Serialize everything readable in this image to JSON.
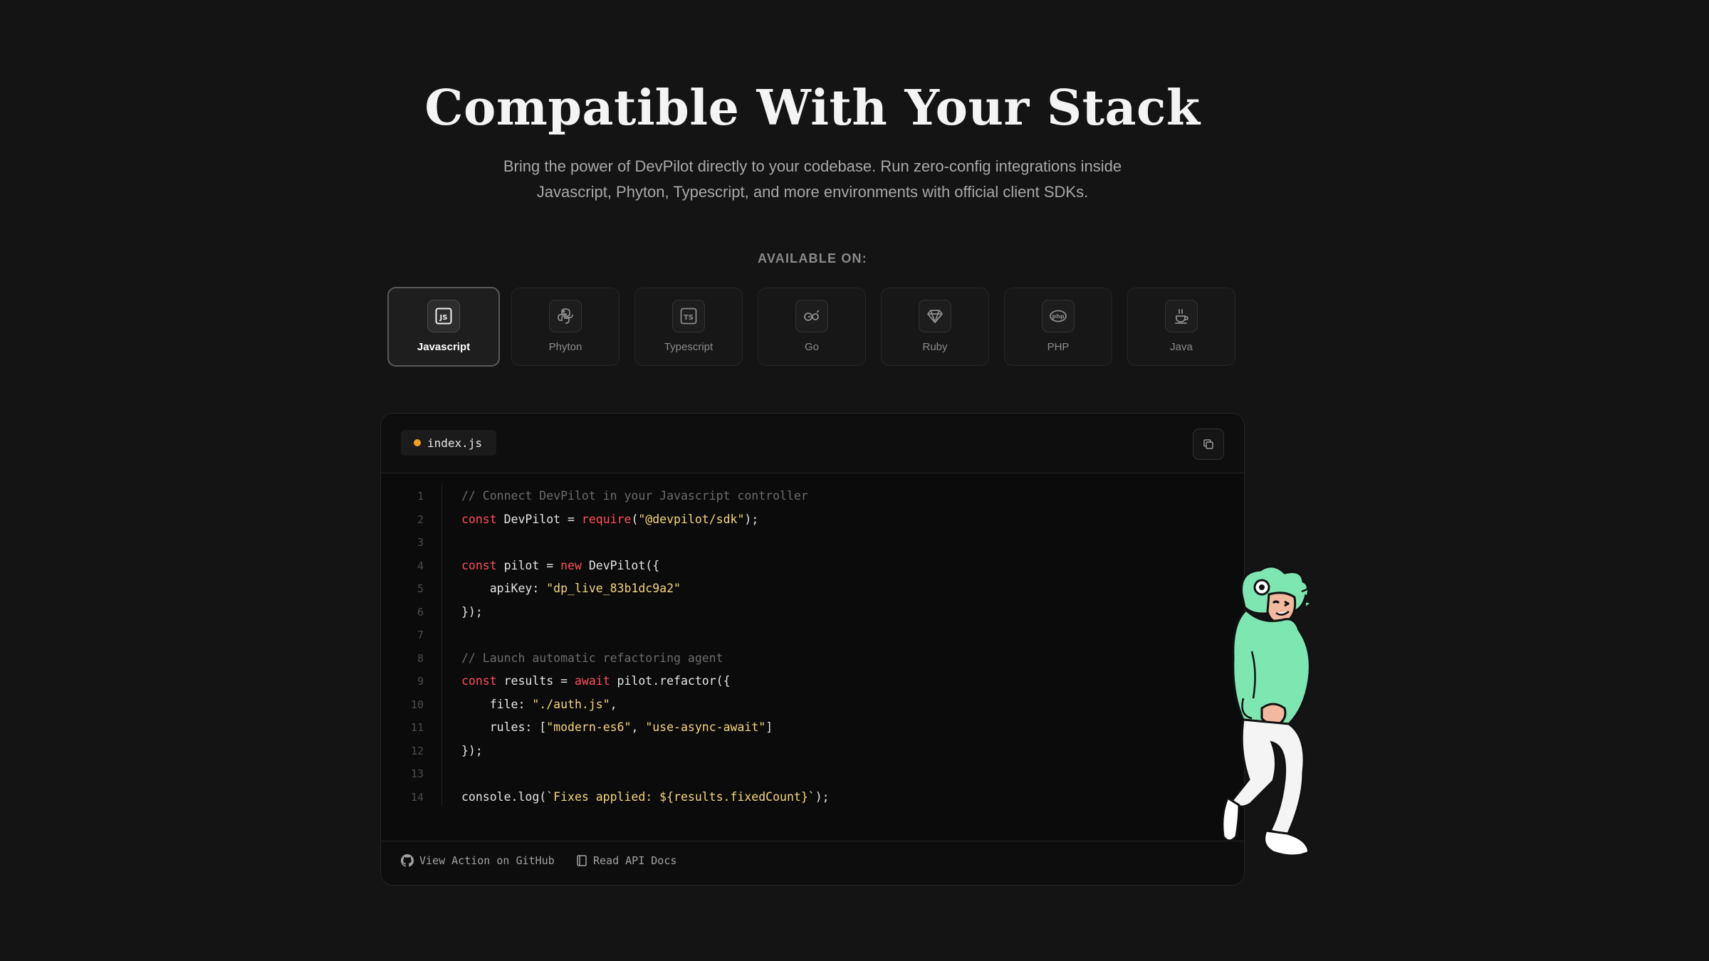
{
  "header": {
    "title": "Compatible With Your Stack",
    "subtitle_line1": "Bring the power of DevPilot directly to your codebase. Run zero-config integrations inside",
    "subtitle_line2": "Javascript, Phyton, Typescript, and more environments with official client SDKs.",
    "available_label": "AVAILABLE ON:"
  },
  "languages": [
    {
      "label": "Javascript",
      "icon": "javascript-icon",
      "active": true
    },
    {
      "label": "Phyton",
      "icon": "python-icon",
      "active": false
    },
    {
      "label": "Typescript",
      "icon": "typescript-icon",
      "active": false
    },
    {
      "label": "Go",
      "icon": "go-icon",
      "active": false
    },
    {
      "label": "Ruby",
      "icon": "ruby-icon",
      "active": false
    },
    {
      "label": "PHP",
      "icon": "php-icon",
      "active": false
    },
    {
      "label": "Java",
      "icon": "java-icon",
      "active": false
    }
  ],
  "editor": {
    "filename": "index.js",
    "file_dot_color": "#f0a020",
    "lines": [
      {
        "n": "1",
        "tokens": [
          [
            "cmt",
            "// Connect DevPilot in your Javascript controller"
          ]
        ]
      },
      {
        "n": "2",
        "tokens": [
          [
            "kw",
            "const"
          ],
          [
            "txt",
            " DevPilot = "
          ],
          [
            "kw",
            "require"
          ],
          [
            "txt",
            "("
          ],
          [
            "str",
            "\"@devpilot/sdk\""
          ],
          [
            "txt",
            ");"
          ]
        ]
      },
      {
        "n": "3",
        "tokens": []
      },
      {
        "n": "4",
        "tokens": [
          [
            "kw",
            "const"
          ],
          [
            "txt",
            " pilot = "
          ],
          [
            "kw",
            "new"
          ],
          [
            "txt",
            " DevPilot({"
          ]
        ]
      },
      {
        "n": "5",
        "tokens": [
          [
            "txt",
            "    apiKey: "
          ],
          [
            "str",
            "\"dp_live_83b1dc9a2\""
          ]
        ]
      },
      {
        "n": "6",
        "tokens": [
          [
            "txt",
            "});"
          ]
        ]
      },
      {
        "n": "7",
        "tokens": []
      },
      {
        "n": "8",
        "tokens": [
          [
            "cmt",
            "// Launch automatic refactoring agent"
          ]
        ]
      },
      {
        "n": "9",
        "tokens": [
          [
            "kw",
            "const"
          ],
          [
            "txt",
            " results = "
          ],
          [
            "kw",
            "await"
          ],
          [
            "txt",
            " pilot.refactor({"
          ]
        ]
      },
      {
        "n": "10",
        "tokens": [
          [
            "txt",
            "    file: "
          ],
          [
            "str",
            "\"./auth.js\""
          ],
          [
            "txt",
            ","
          ]
        ]
      },
      {
        "n": "11",
        "tokens": [
          [
            "txt",
            "    rules: ["
          ],
          [
            "str",
            "\"modern-es6\""
          ],
          [
            "txt",
            ", "
          ],
          [
            "str",
            "\"use-async-await\""
          ],
          [
            "txt",
            "]"
          ]
        ]
      },
      {
        "n": "12",
        "tokens": [
          [
            "txt",
            "});"
          ]
        ]
      },
      {
        "n": "13",
        "tokens": []
      },
      {
        "n": "14",
        "tokens": [
          [
            "txt",
            "console.log(`"
          ],
          [
            "str",
            "Fixes applied: ${results.fixedCount}"
          ],
          [
            "txt",
            "`);"
          ]
        ]
      }
    ]
  },
  "footer": {
    "github_label": "View Action on GitHub",
    "docs_label": "Read API Docs"
  },
  "colors": {
    "background": "#141414",
    "keyword": "#ff4d5e",
    "string": "#f5d77a",
    "comment": "#6c6c6c",
    "mascot_green": "#7ee6b0"
  }
}
